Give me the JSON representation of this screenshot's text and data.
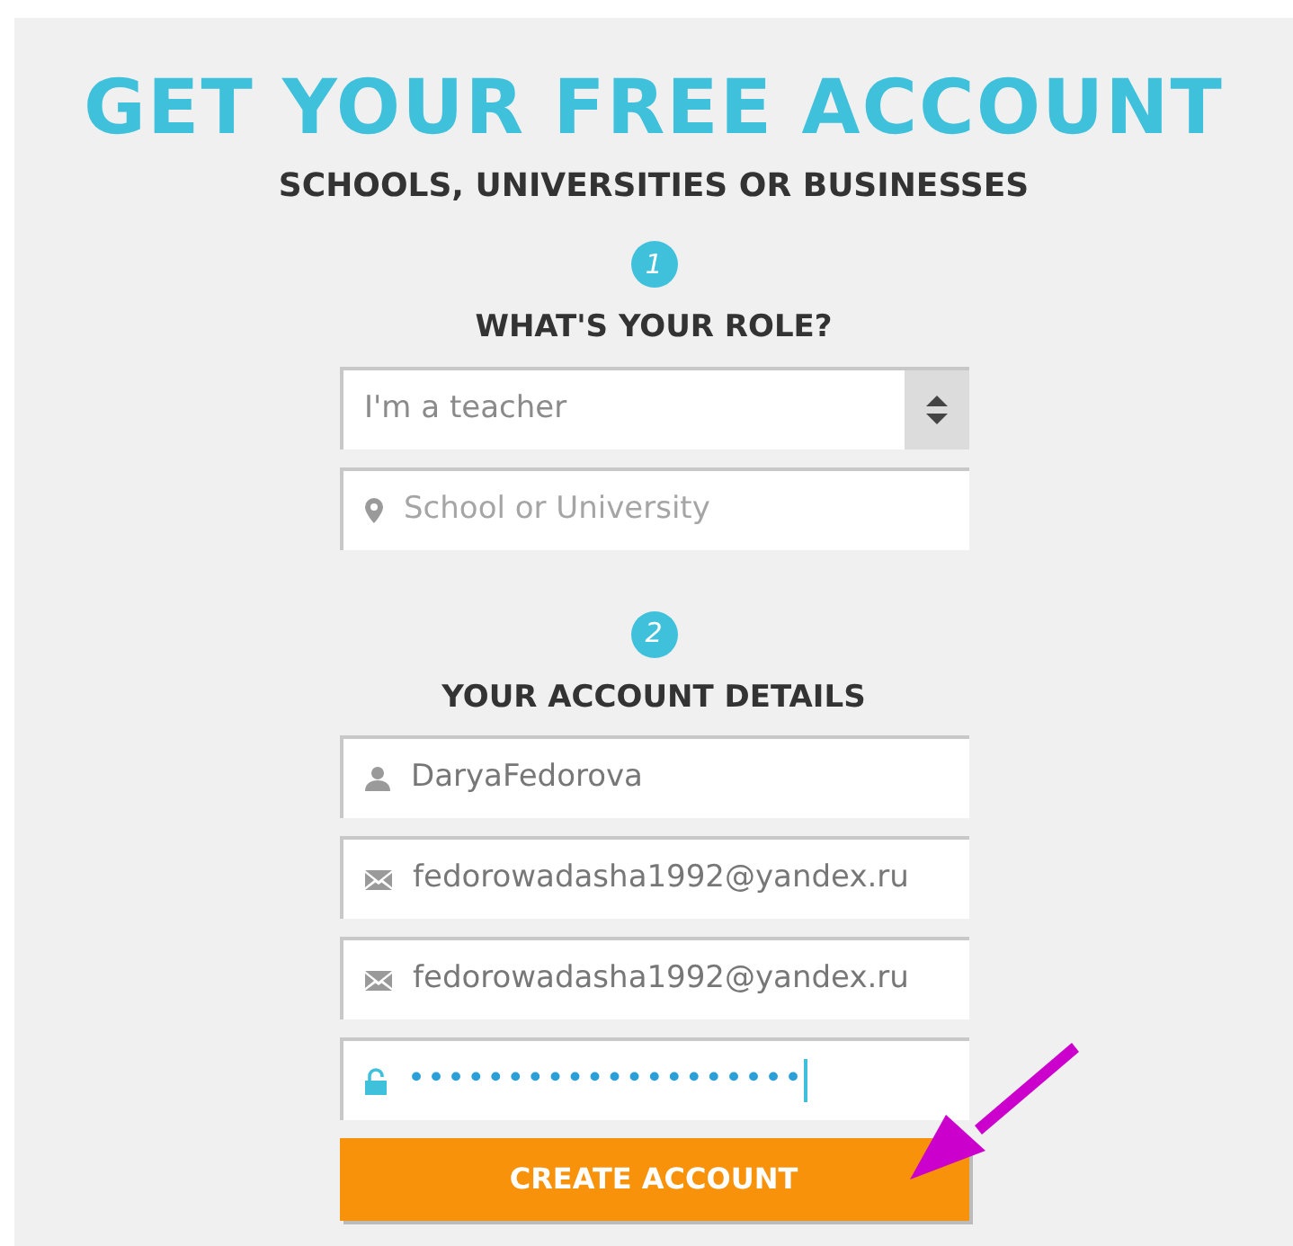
{
  "title": "GET YOUR FREE ACCOUNT",
  "subtitle": "SCHOOLS, UNIVERSITIES OR BUSINESSES",
  "steps": [
    {
      "number": "1",
      "heading": "WHAT'S YOUR ROLE?",
      "fields": [
        {
          "kind": "select",
          "value": "I'm a teacher"
        },
        {
          "kind": "location",
          "placeholder": "School or University"
        }
      ]
    },
    {
      "number": "2",
      "heading": "YOUR ACCOUNT DETAILS",
      "fields": [
        {
          "kind": "user",
          "value": "DaryaFedorova"
        },
        {
          "kind": "email",
          "value": "fedorowadasha1992@yandex.ru"
        },
        {
          "kind": "email",
          "value": "fedorowadasha1992@yandex.ru"
        },
        {
          "kind": "password",
          "value": "••••••••••••••••••••",
          "focused": true
        }
      ]
    }
  ],
  "button": "CREATE ACCOUNT"
}
